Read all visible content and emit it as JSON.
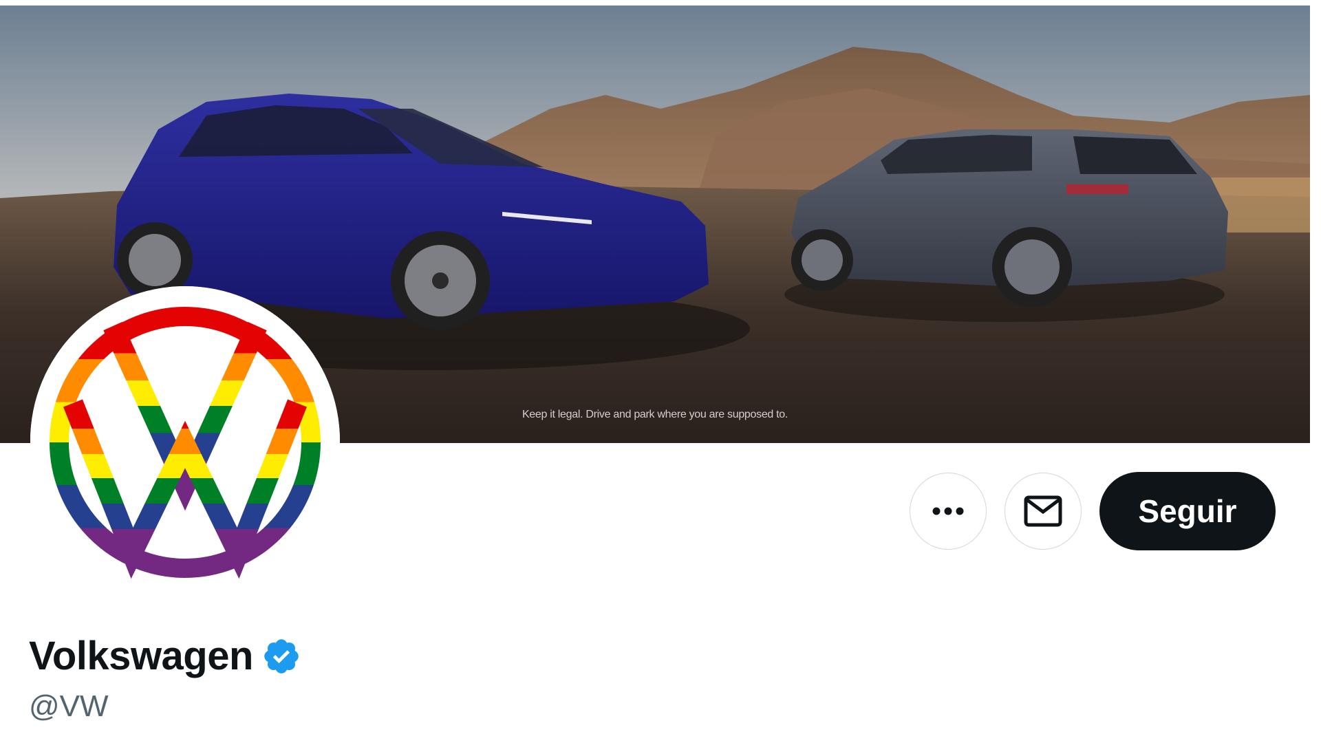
{
  "banner": {
    "caption": "Keep it legal. Drive and park where you are supposed to."
  },
  "avatar": {
    "logo": "volkswagen-logo-rainbow",
    "colors": [
      "#e40303",
      "#ff8c00",
      "#ffed00",
      "#008026",
      "#24408e",
      "#732982"
    ]
  },
  "actions": {
    "more_icon": "more-horizontal-icon",
    "message_icon": "envelope-icon",
    "follow_label": "Seguir"
  },
  "profile": {
    "name": "Volkswagen",
    "verified_icon": "verified-badge-icon",
    "handle": "@VW"
  },
  "colors": {
    "follow_bg": "#0f1419",
    "verified": "#1d9bf0",
    "handle": "#536471"
  }
}
